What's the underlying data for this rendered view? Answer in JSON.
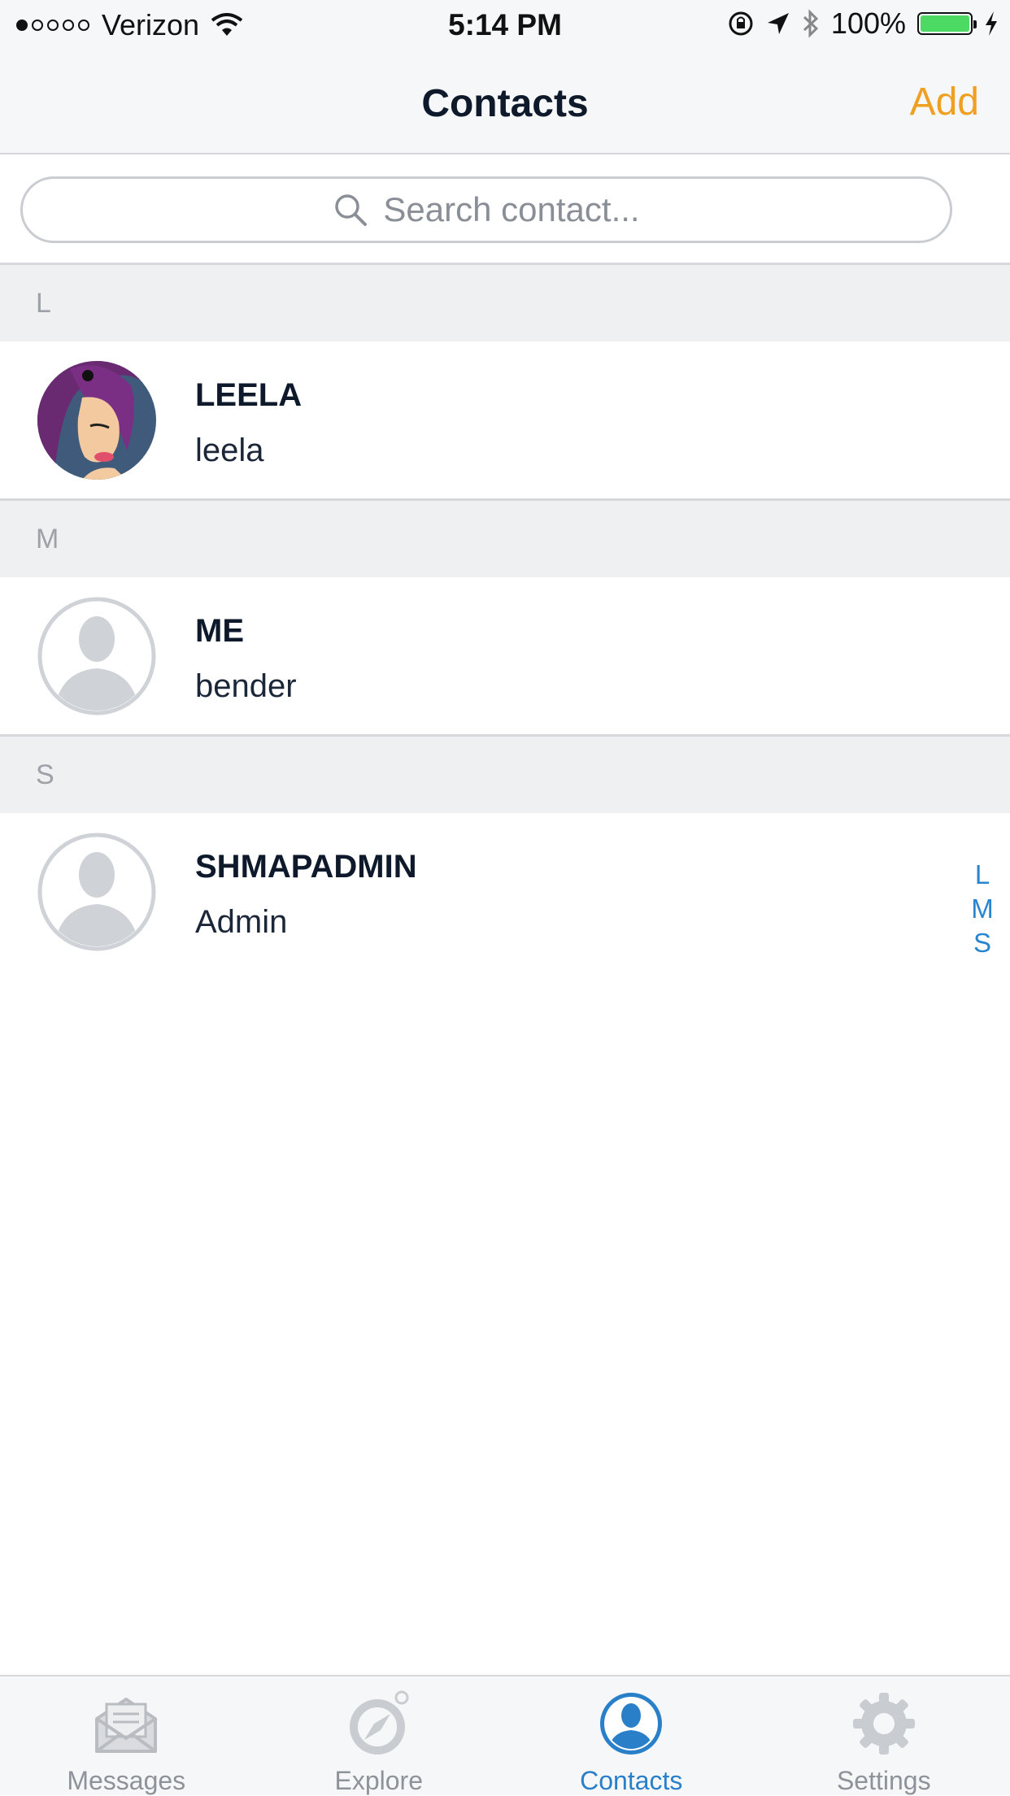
{
  "status_bar": {
    "carrier": "Verizon",
    "time": "5:14 PM",
    "battery_percent": "100%",
    "signal_bars_filled": 1,
    "signal_bars_total": 5
  },
  "nav": {
    "title": "Contacts",
    "add_label": "Add"
  },
  "search": {
    "placeholder": "Search contact..."
  },
  "sections": [
    {
      "letter": "L",
      "contacts": [
        {
          "name": "LEELA",
          "username": "leela",
          "avatar": "photo"
        }
      ]
    },
    {
      "letter": "M",
      "contacts": [
        {
          "name": "ME",
          "username": "bender",
          "avatar": "placeholder-person-icon"
        }
      ]
    },
    {
      "letter": "S",
      "contacts": [
        {
          "name": "SHMAPADMIN",
          "username": "Admin",
          "avatar": "placeholder-person-icon"
        }
      ]
    }
  ],
  "index": [
    "L",
    "M",
    "S"
  ],
  "tabs": [
    {
      "label": "Messages",
      "icon": "envelope-icon",
      "active": false
    },
    {
      "label": "Explore",
      "icon": "compass-icon",
      "active": false
    },
    {
      "label": "Contacts",
      "icon": "person-icon",
      "active": true
    },
    {
      "label": "Settings",
      "icon": "gear-icon",
      "active": false
    }
  ],
  "colors": {
    "accent_add": "#f0a020",
    "active_tab": "#2a7fc9",
    "index_letters": "#2a85d0",
    "battery_fill": "#4cd964"
  }
}
